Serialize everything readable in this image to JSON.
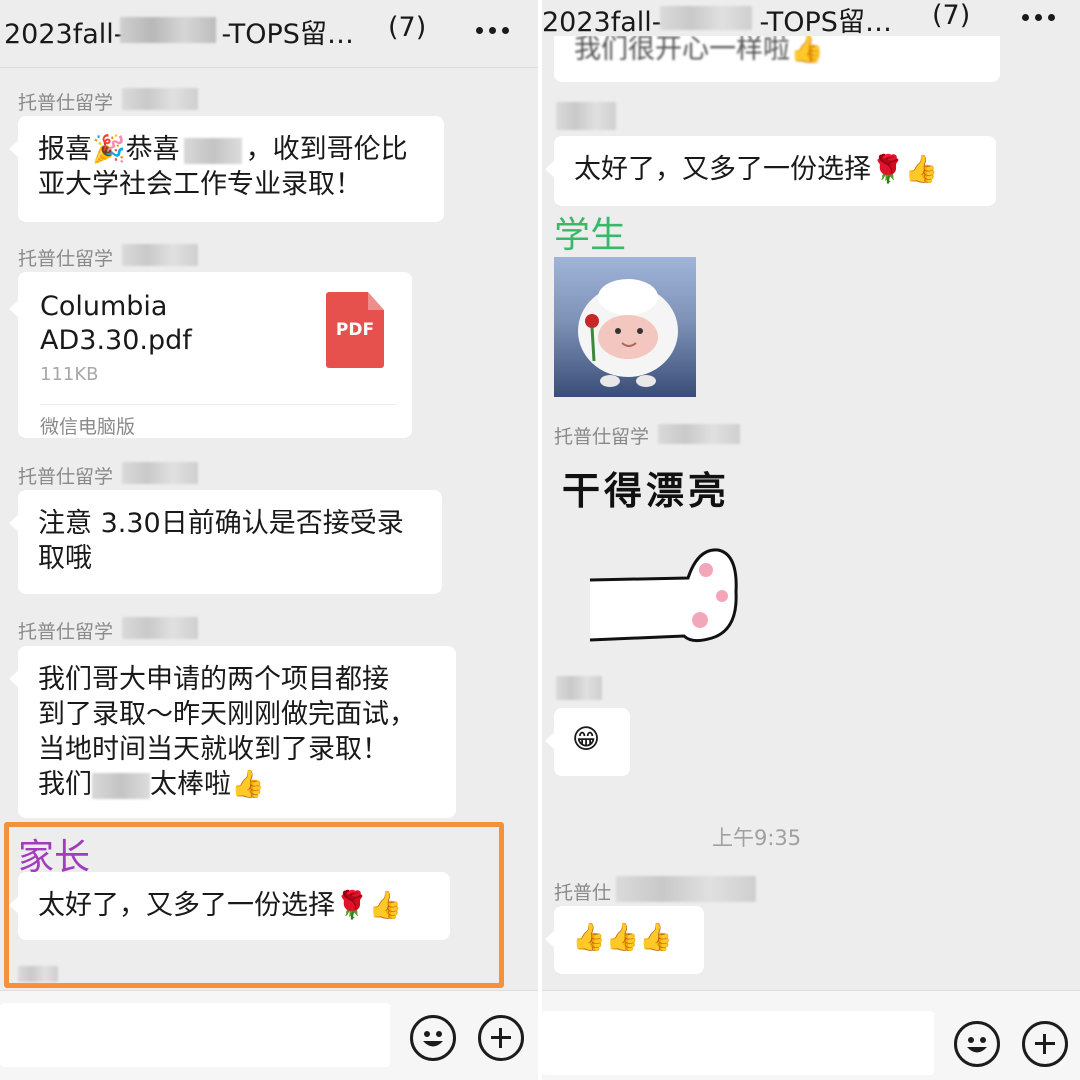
{
  "left": {
    "header": {
      "title": "2023fall-",
      "title_suffix": "-TOPS留…",
      "count": "(7)"
    },
    "messages": [
      {
        "sender": "托普仕留学",
        "lines": [
          "报喜🎉恭喜",
          "，收到哥伦比",
          "亚大学社会工作专业录取！"
        ]
      },
      {
        "sender": "托普仕留学",
        "file": {
          "name_line1": "Columbia",
          "name_line2": "AD3.30.pdf",
          "size": "111KB",
          "source": "微信电脑版",
          "icon_label": "PDF"
        }
      },
      {
        "sender": "托普仕留学",
        "lines": [
          "注意 3.30日前确认是否接受录",
          "取哦"
        ]
      },
      {
        "sender": "托普仕留学",
        "lines": [
          "我们哥大申请的两个项目都接",
          "到了录取～昨天刚刚做完面试，",
          "当地时间当天就收到了录取！",
          "我们",
          "太棒啦👍"
        ]
      }
    ],
    "highlight": {
      "role": "家长",
      "text": "太好了，又多了一份选择🌹👍",
      "role_color": "#a23bbd",
      "border_color": "#f5913a"
    }
  },
  "right": {
    "header": {
      "title": "2023fall-",
      "title_suffix": "-TOPS留…",
      "count": "(7)"
    },
    "top_partial_text": "我们很开心一样啦👍",
    "reply": {
      "text": "太好了，又多了一份选择🌹👍"
    },
    "student_label": {
      "role": "学生",
      "role_color": "#3ab86a"
    },
    "sticker_sender": "托普仕留学",
    "sticker_text": "干得漂亮",
    "grin_emoji": "😁",
    "timestamp": "上午9:35",
    "last_sender": "托普仕",
    "last_message": "👍👍👍"
  },
  "icons": [
    "more-icon",
    "pdf-icon",
    "smile-icon",
    "plus-icon"
  ]
}
